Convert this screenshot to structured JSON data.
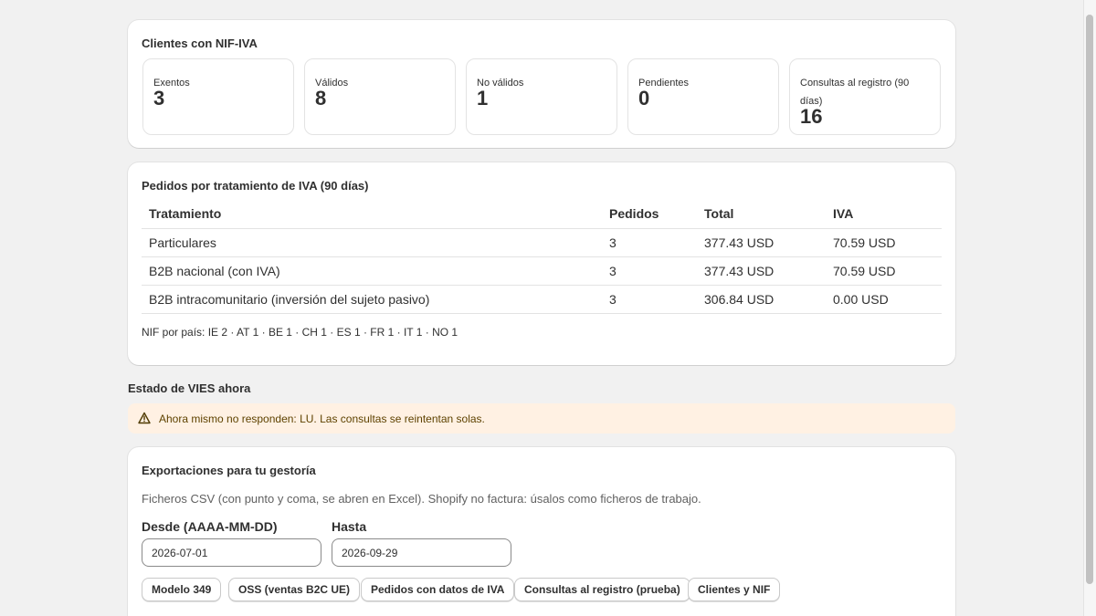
{
  "clients": {
    "title": "Clientes con NIF-IVA",
    "stats": [
      {
        "label": "Exentos",
        "value": "3"
      },
      {
        "label": "Válidos",
        "value": "8"
      },
      {
        "label": "No válidos",
        "value": "1"
      },
      {
        "label": "Pendientes",
        "value": "0"
      },
      {
        "label": "Consultas al registro (90 días)",
        "value": "16"
      }
    ]
  },
  "orders": {
    "title": "Pedidos por tratamiento de IVA (90 días)",
    "columns": [
      "Tratamiento",
      "Pedidos",
      "Total",
      "IVA"
    ],
    "rows": [
      [
        "Particulares",
        "3",
        "377.43 USD",
        "70.59 USD"
      ],
      [
        "B2B nacional (con IVA)",
        "3",
        "377.43 USD",
        "70.59 USD"
      ],
      [
        "B2B intracomunitario (inversión del sujeto pasivo)",
        "3",
        "306.84 USD",
        "0.00 USD"
      ]
    ],
    "nif_by_country": "NIF por país: IE 2 · AT 1 · BE 1 · CH 1 · ES 1 · FR 1 · IT 1 · NO 1"
  },
  "vies": {
    "heading": "Estado de VIES ahora",
    "warning": "Ahora mismo no responden: LU. Las consultas se reintentan solas.",
    "warning_icon": "warning-triangle-icon"
  },
  "exports": {
    "title": "Exportaciones para tu gestoría",
    "description": "Ficheros CSV (con punto y coma, se abren en Excel). Shopify no factura: úsalos como ficheros de trabajo.",
    "from_label": "Desde (AAAA-MM-DD)",
    "from_value": "2026-07-01",
    "to_label": "Hasta",
    "to_value": "2026-09-29",
    "buttons": [
      "Modelo 349",
      "OSS (ventas B2C UE)",
      "Pedidos con datos de IVA",
      "Consultas al registro (prueba)",
      "Clientes y NIF"
    ]
  },
  "colors": {
    "background": "#f1f1f1",
    "card": "#ffffff",
    "warning_bg": "#fff1e3",
    "warning_text": "#5e4200"
  }
}
